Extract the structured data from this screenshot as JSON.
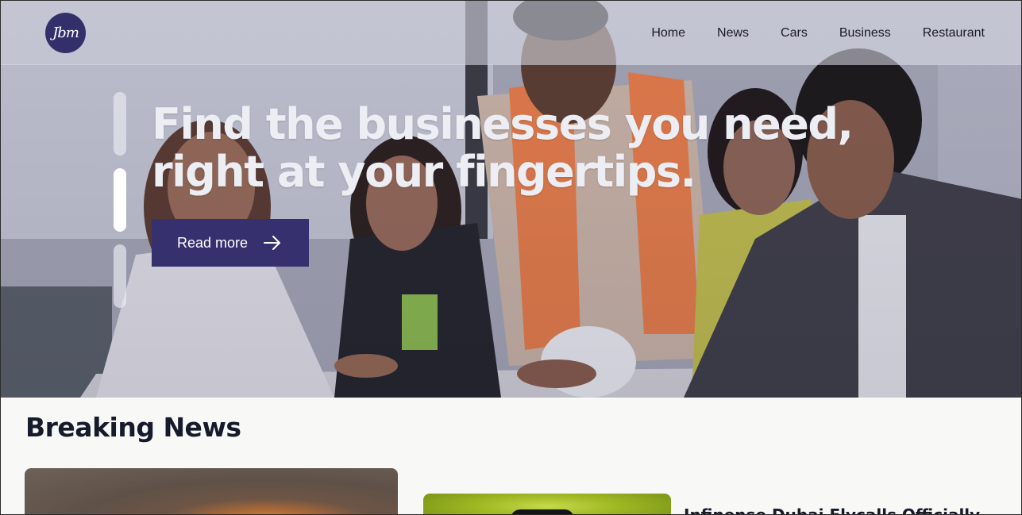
{
  "brand": {
    "logo_text": "Jbm"
  },
  "nav": {
    "items": [
      {
        "label": "Home"
      },
      {
        "label": "News"
      },
      {
        "label": "Cars"
      },
      {
        "label": "Business"
      },
      {
        "label": "Restaurant"
      }
    ]
  },
  "hero": {
    "title_line1": "Find the businesses you need,",
    "title_line2": "right at your fingertips.",
    "cta_label": "Read more",
    "slides": {
      "count": 3,
      "active_index": 1
    }
  },
  "breaking_news": {
    "heading": "Breaking News",
    "cards": [
      {
        "title": ""
      },
      {
        "title": "Infinense Dubai Flycalls Officially"
      }
    ]
  },
  "colors": {
    "brand_primary": "#36306e",
    "heading_text": "#161a2b",
    "page_background": "#f8f8f7"
  },
  "icons": {
    "cta": "arrow-right-icon"
  }
}
